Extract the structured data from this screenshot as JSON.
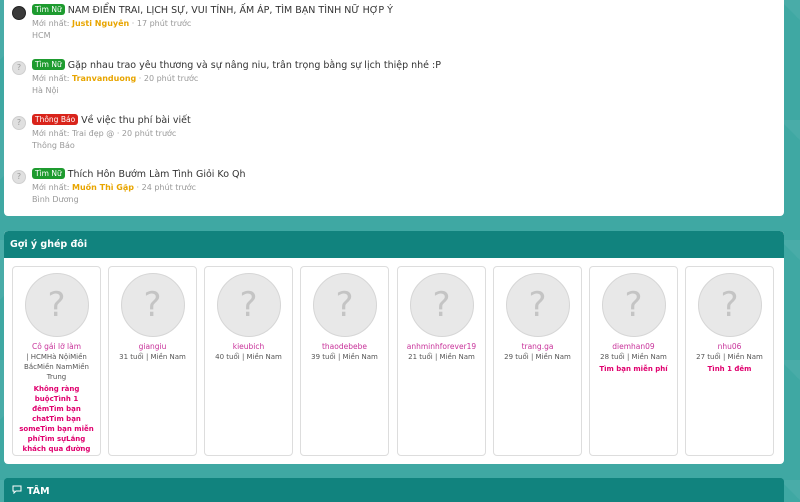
{
  "threads": [
    {
      "badge": "Tìm Nữ",
      "badge_color": "green",
      "title": "NAM ĐIỂN TRAI, LỊCH SỰ, VUI TÍNH, ẤM ÁP, TÌM BẠN TÌNH NỮ HỢP Ý",
      "latest_label": "Mới nhất:",
      "user": "Justi Nguyên",
      "time": "· 17 phút trước",
      "location": "HCM"
    },
    {
      "badge": "Tìm Nữ",
      "badge_color": "green",
      "title": "Gặp nhau trao yêu thương và sự nâng niu, trân trọng bằng sự lịch thiệp nhé :P",
      "latest_label": "Mới nhất:",
      "user": "Tranvanduong",
      "time": "· 20 phút trước",
      "location": "Hà Nội"
    },
    {
      "badge": "Thông Báo",
      "badge_color": "red",
      "title": "Về việc thu phí bài viết",
      "latest_label": "Mới nhất:",
      "user": "Trai đẹp @",
      "time": "· 20 phút trước",
      "location": "Thông Báo"
    },
    {
      "badge": "Tìm Nữ",
      "badge_color": "green",
      "title": "Thích Hôn Bướm Làm Tình Giỏi Ko Qh",
      "latest_label": "Mới nhất:",
      "user": "Muốn Thì Gặp",
      "time": "· 24 phút trước",
      "location": "Bình Dương"
    }
  ],
  "match": {
    "title": "Gợi ý ghép đôi",
    "avatar_glyph": "?",
    "cards": [
      {
        "name": "Cô gái lỡ làm",
        "meta": "| HCMHà NộiMiền BắcMiền NamMiền Trung",
        "tags": "Không ràng buộcTình 1 đêmTìm bạn chatTìm bạn someTìm bạn miễn phíTìm sựLắng khách qua đường"
      },
      {
        "name": "giangiu",
        "meta": "31 tuổi | Miền Nam",
        "tags": ""
      },
      {
        "name": "kieubich",
        "meta": "40 tuổi | Miền Nam",
        "tags": ""
      },
      {
        "name": "thaodebebe",
        "meta": "39 tuổi | Miền Nam",
        "tags": ""
      },
      {
        "name": "anhminhforever19",
        "meta": "21 tuổi | Miền Nam",
        "tags": ""
      },
      {
        "name": "trang.ga",
        "meta": "29 tuổi | Miền Nam",
        "tags": ""
      },
      {
        "name": "diemhan09",
        "meta": "28 tuổi | Miền Nam",
        "tags": "Tìm bạn miễn phí"
      },
      {
        "name": "nhu06",
        "meta": "27 tuổi | Miền Nam",
        "tags": "Tình 1 đêm"
      }
    ]
  },
  "tam": {
    "title": "TÂM",
    "icon": "chat-icon"
  }
}
